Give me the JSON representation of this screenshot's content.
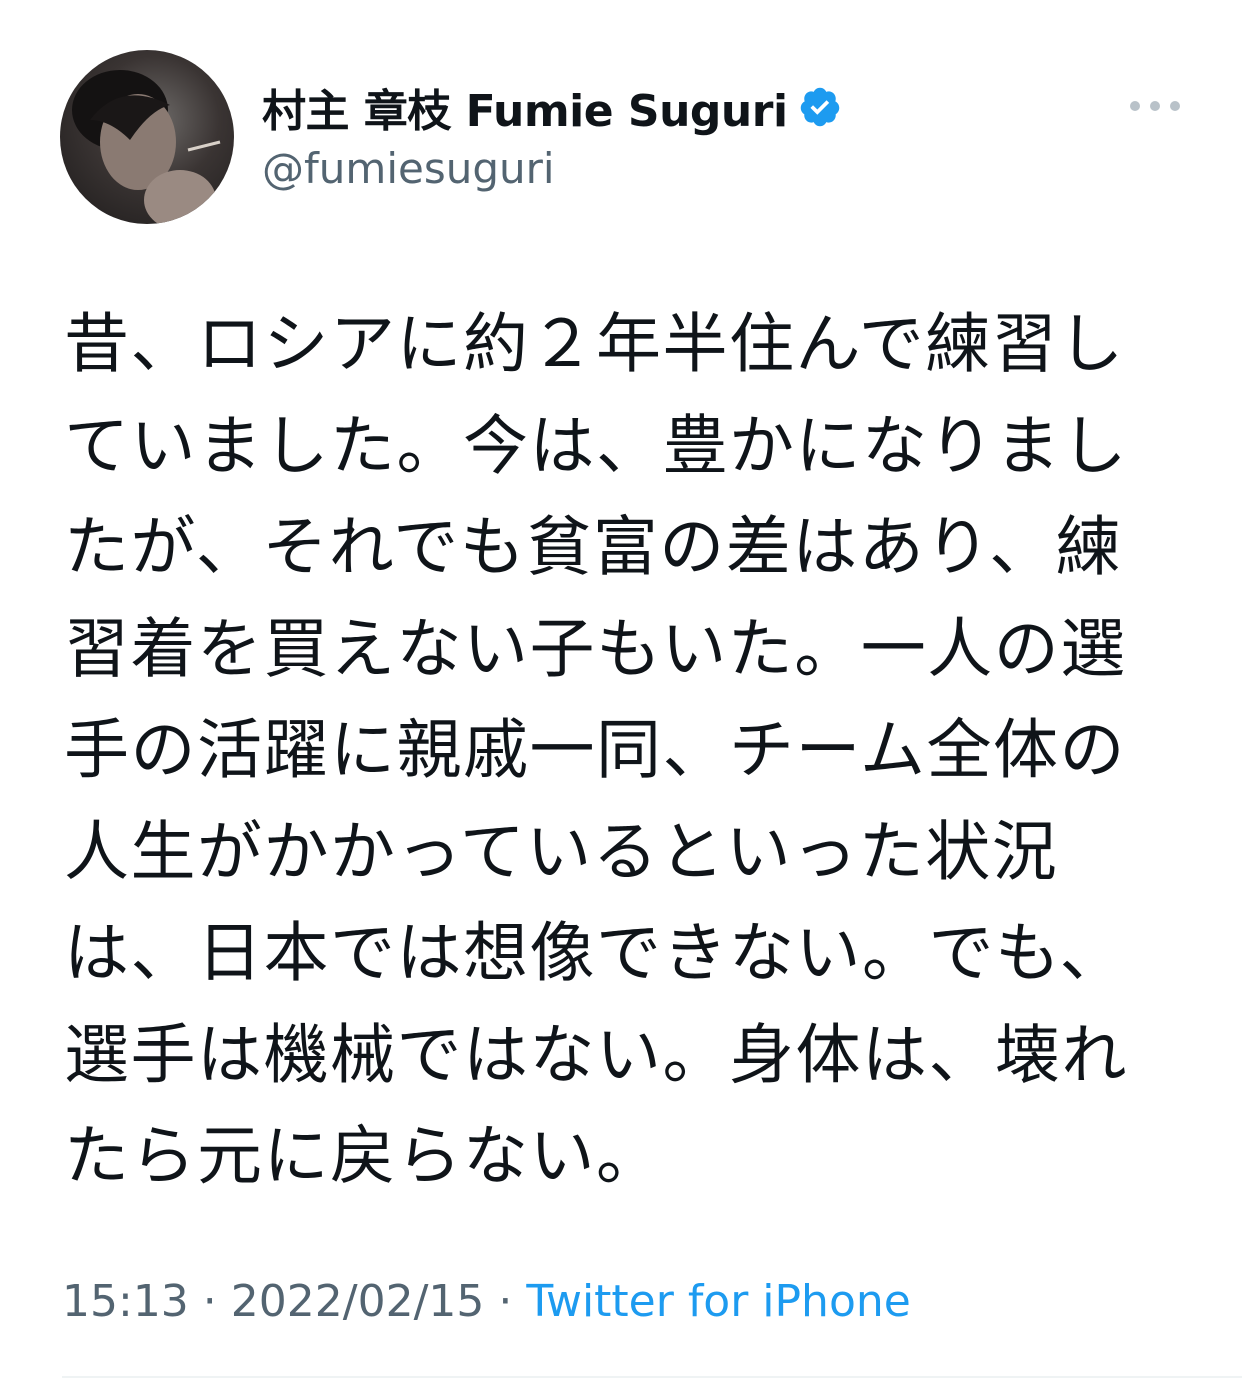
{
  "author": {
    "display_name": "村主 章枝 Fumie Suguri",
    "handle": "@fumiesuguri",
    "verified": true,
    "verified_icon": "verified-badge-icon",
    "verified_color": "#1d9bf0"
  },
  "more_icon": "more-horizontal-icon",
  "tweet": {
    "lines": [
      "昔、ロシアに約２年半住んで練習し",
      "ていました。今は、豊かになりまし",
      "たが、それでも貧富の差はあり、練",
      "習着を買えない子もいた。一人の選",
      "手の活躍に親戚一同、チーム全体の",
      "人生がかかっているといった状況",
      "は、日本では想像できない。でも、",
      "選手は機械ではない。身体は、壊れ",
      "たら元に戻らない。"
    ]
  },
  "meta": {
    "time": "15:13",
    "separator": " · ",
    "date": "2022/02/15",
    "source": "Twitter for iPhone"
  },
  "colors": {
    "text": "#0f1419",
    "secondary": "#536471",
    "link": "#1d9bf0"
  }
}
